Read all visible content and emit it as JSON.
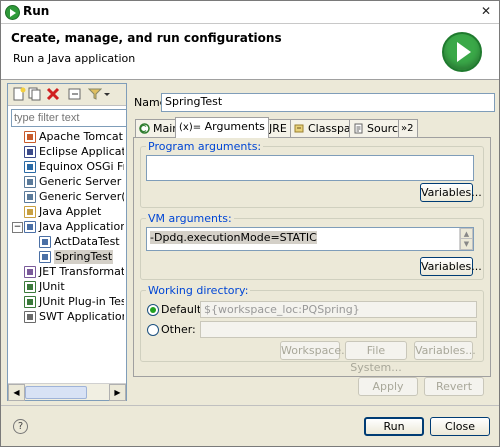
{
  "window": {
    "title": "Run"
  },
  "header": {
    "title": "Create, manage, and run configurations",
    "subtitle": "Run a Java application"
  },
  "left": {
    "filter_placeholder": "type filter text",
    "tree": [
      {
        "label": "Apache Tomcat",
        "icon": "tomcat-icon",
        "level": 1
      },
      {
        "label": "Eclipse Application",
        "icon": "eclipse-icon",
        "level": 1
      },
      {
        "label": "Equinox OSGi Frar",
        "icon": "osgi-icon",
        "level": 1
      },
      {
        "label": "Generic Server",
        "icon": "server-icon",
        "level": 1
      },
      {
        "label": "Generic Server(Ex",
        "icon": "server-icon",
        "level": 1
      },
      {
        "label": "Java Applet",
        "icon": "applet-icon",
        "level": 1
      },
      {
        "label": "Java Application",
        "icon": "java-app-icon",
        "level": 1,
        "expanded": true
      },
      {
        "label": "ActDataTest",
        "icon": "java-class-icon",
        "level": 2
      },
      {
        "label": "SpringTest",
        "icon": "java-class-icon",
        "level": 2,
        "selected": true
      },
      {
        "label": "JET Transformatio",
        "icon": "jet-icon",
        "level": 1
      },
      {
        "label": "JUnit",
        "icon": "junit-icon",
        "level": 1
      },
      {
        "label": "JUnit Plug-in Test",
        "icon": "junit-plugin-icon",
        "level": 1
      },
      {
        "label": "SWT Application",
        "icon": "swt-icon",
        "level": 1
      }
    ]
  },
  "config": {
    "name_label": "Name:",
    "name_value": "SpringTest",
    "tabs": [
      {
        "label": "Main",
        "icon": "main-tab-icon"
      },
      {
        "label": "Arguments",
        "icon": "arguments-tab-icon",
        "prefix": "(x)=",
        "active": true
      },
      {
        "label": "JRE",
        "icon": "jre-tab-icon"
      },
      {
        "label": "Classpath",
        "icon": "classpath-tab-icon"
      },
      {
        "label": "Source",
        "icon": "source-tab-icon"
      }
    ],
    "tab_overflow": "»2",
    "program_args": {
      "label": "Program arguments:",
      "value": "",
      "variables_button": "Variables..."
    },
    "vm_args": {
      "label": "VM arguments:",
      "value": "-Dpdq.executionMode=STATIC",
      "variables_button": "Variables..."
    },
    "working_dir": {
      "label": "Working directory:",
      "default_label": "Default:",
      "default_value": "${workspace_loc:PQSpring}",
      "other_label": "Other:",
      "other_value": "",
      "selected": "default",
      "workspace_button": "Workspace...",
      "filesystem_button": "File System...",
      "variables_button": "Variables..."
    }
  },
  "buttons": {
    "apply": "Apply",
    "revert": "Revert",
    "run": "Run",
    "close": "Close"
  },
  "colors": {
    "accent_legend": "#0046d5",
    "run_icon": "#3aa848"
  }
}
